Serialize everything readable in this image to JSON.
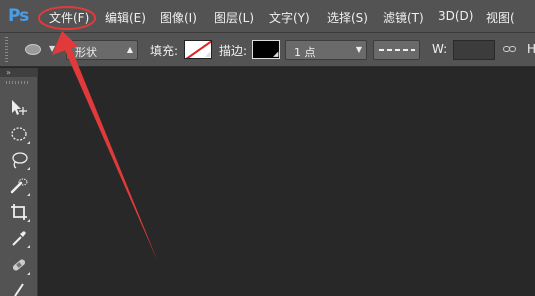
{
  "app": {
    "logo": "Ps",
    "accent": "#4a9de8"
  },
  "menu": [
    {
      "label": "文件(F)"
    },
    {
      "label": "编辑(E)"
    },
    {
      "label": "图像(I)"
    },
    {
      "label": "图层(L)"
    },
    {
      "label": "文字(Y)"
    },
    {
      "label": "选择(S)"
    },
    {
      "label": "滤镜(T)"
    },
    {
      "label": "3D(D)"
    },
    {
      "label": "视图("
    }
  ],
  "options": {
    "mode_value": "形状",
    "fill_label": "填充:",
    "stroke_label": "描边:",
    "stroke_width_value": "1 点",
    "width_label": "W:",
    "height_label": "H"
  },
  "annotation": {
    "color": "#e03a3a",
    "target": "文件(F)"
  }
}
